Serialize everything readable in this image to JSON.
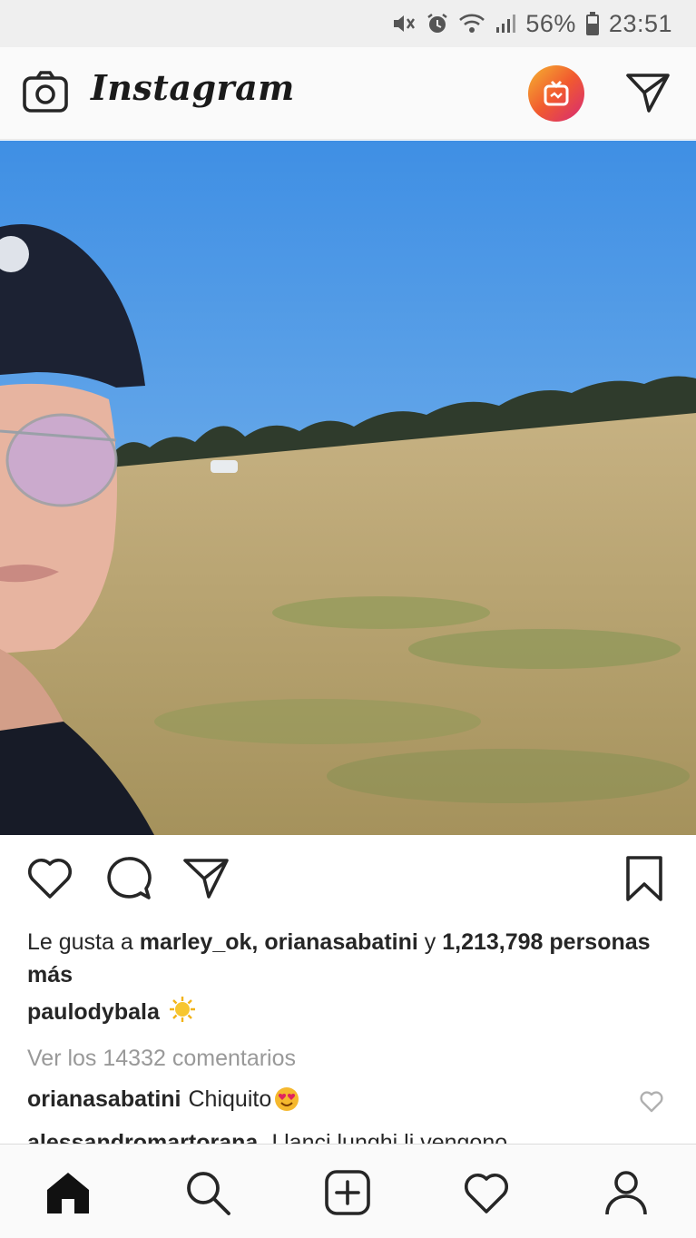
{
  "status_bar": {
    "battery": "56%",
    "time": "23:51",
    "icons": [
      "mute-icon",
      "alarm-icon",
      "wifi-icon",
      "signal-icon",
      "battery-icon"
    ]
  },
  "header": {
    "app_name": "Instagram",
    "left_icon": "camera-icon",
    "igtv_icon": "igtv-icon",
    "right_icon": "direct-message-icon"
  },
  "post": {
    "photo_description_icon": "photo",
    "likes": {
      "prefix": "Le gusta a",
      "user1": "marley_ok,",
      "user2": "orianasabatini",
      "connector": "y",
      "count": "1,213,798",
      "suffix": "personas más"
    },
    "caption_user": "paulodybala",
    "view_comments": "Ver los 14332 comentarios",
    "comments": [
      {
        "user": "orianasabatini",
        "text": "Chiquito"
      },
      {
        "user": "alessandromartorana",
        "text": "I lanci lunghi li vengono"
      }
    ]
  },
  "actions": [
    "like-icon",
    "comment-icon",
    "share-icon",
    "bookmark-icon"
  ],
  "bottom_nav": [
    "home-icon",
    "search-icon",
    "new-post-icon",
    "activity-icon",
    "profile-icon"
  ],
  "colors": {
    "igtv_gradient_start": "#f5b431",
    "igtv_gradient_end": "#d62976",
    "sky": "#4b96e6",
    "field": "#b9a473"
  }
}
